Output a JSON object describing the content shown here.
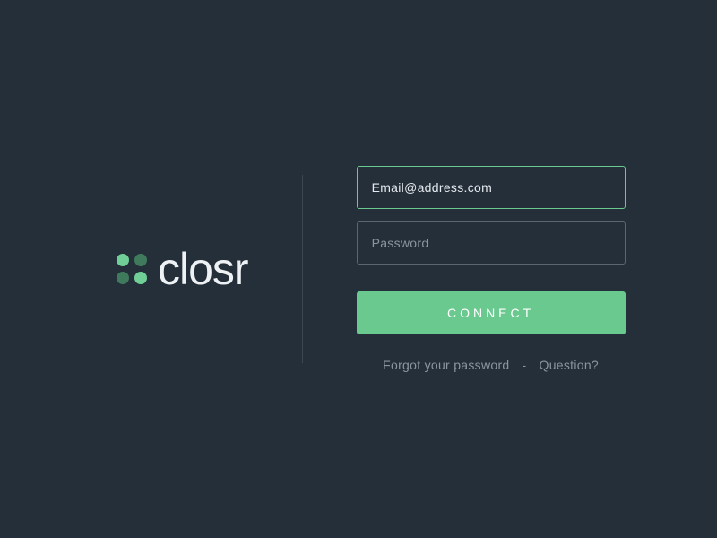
{
  "brand": {
    "name": "closr"
  },
  "form": {
    "email_value": "Email@address.com",
    "password_placeholder": "Password",
    "connect_label": "CONNECT"
  },
  "links": {
    "forgot": "Forgot your password",
    "separator": "-",
    "question": "Question?"
  },
  "colors": {
    "background": "#242f39",
    "accent": "#69c98e",
    "border": "#5a6670",
    "text_muted": "#8b95a0",
    "text_primary": "#eef2f5"
  }
}
